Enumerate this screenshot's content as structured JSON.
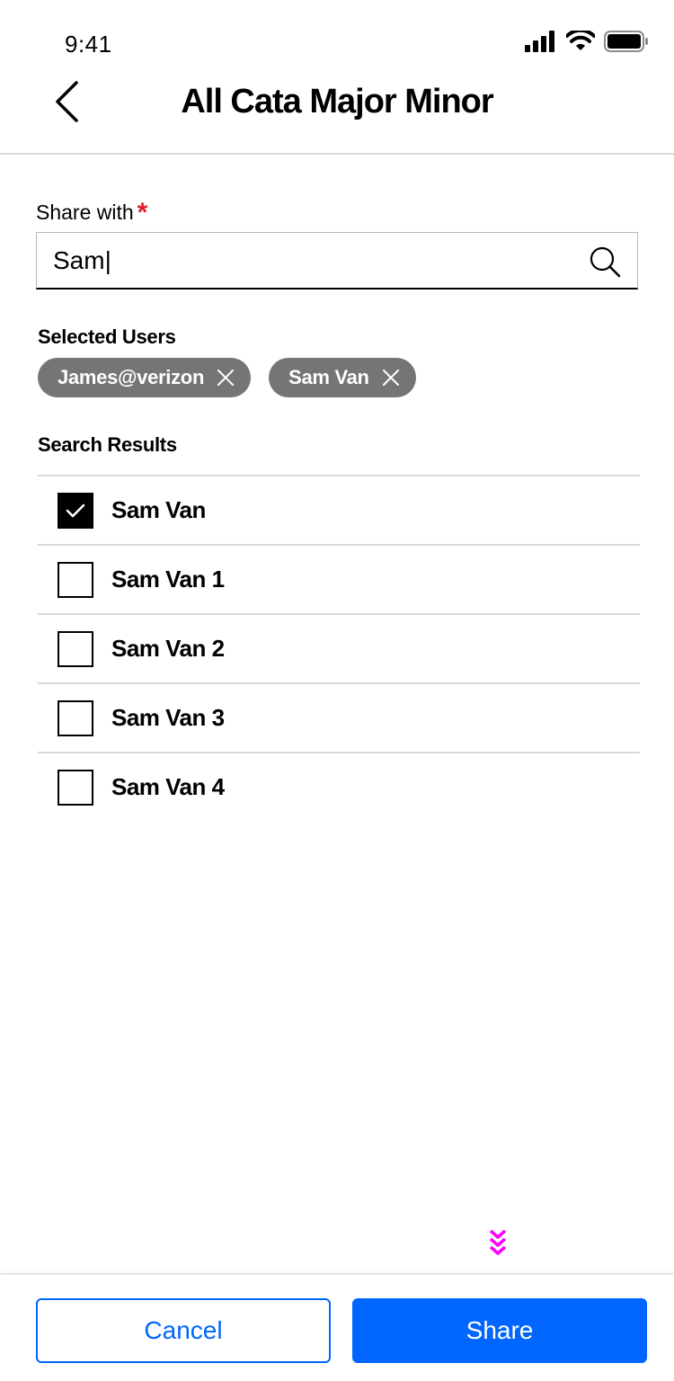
{
  "status_bar": {
    "time": "9:41"
  },
  "header": {
    "title": "All Cata Major Minor"
  },
  "share_with": {
    "label": "Share with",
    "required_mark": "*",
    "value": "Sam|",
    "placeholder": ""
  },
  "selected_users": {
    "title": "Selected Users",
    "chips": [
      {
        "label": "James@verizon"
      },
      {
        "label": "Sam Van"
      }
    ]
  },
  "search_results": {
    "title": "Search Results",
    "items": [
      {
        "label": "Sam Van",
        "checked": true
      },
      {
        "label": "Sam Van 1",
        "checked": false
      },
      {
        "label": "Sam Van 2",
        "checked": false
      },
      {
        "label": "Sam Van 3",
        "checked": false
      },
      {
        "label": "Sam Van 4",
        "checked": false
      }
    ]
  },
  "footer": {
    "cancel_label": "Cancel",
    "share_label": "Share"
  },
  "colors": {
    "accent": "#0066ff",
    "chip": "#747676",
    "required": "#e0202b",
    "scroll_hint": "#ff00ff"
  }
}
